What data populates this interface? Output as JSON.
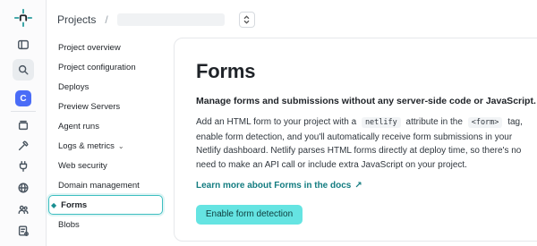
{
  "breadcrumb": {
    "projects_label": "Projects",
    "separator": "/"
  },
  "rail": {
    "team_initial": "C",
    "items": [
      "netlify-logo-icon",
      "sidebar-toggle-icon",
      "search-icon",
      "team-avatar",
      "projects-icon",
      "builds-icon",
      "extensions-icon",
      "domains-icon",
      "members-icon",
      "docs-icon"
    ]
  },
  "subnav": {
    "items": [
      {
        "label": "Project overview"
      },
      {
        "label": "Project configuration"
      },
      {
        "label": "Deploys"
      },
      {
        "label": "Preview Servers"
      },
      {
        "label": "Agent runs"
      },
      {
        "label": "Logs & metrics"
      },
      {
        "label": "Web security"
      },
      {
        "label": "Domain management"
      },
      {
        "label": "Forms"
      },
      {
        "label": "Blobs"
      }
    ],
    "logs_caret": "⌄",
    "active_marker": "◆"
  },
  "main": {
    "title": "Forms",
    "lead": "Manage forms and submissions without any server-side code or JavaScript.",
    "body_part1": "Add an HTML form to your project with a",
    "code1": "netlify",
    "body_part2": "attribute in the",
    "code2": "<form>",
    "body_part3": "tag, enable form detection, and you'll automatically receive form submissions in your Netlify dashboard. Netlify parses HTML forms directly at deploy time, so there's no need to make an API call or include extra JavaScript on your project.",
    "docs_link": "Learn more about Forms in the docs",
    "docs_arrow": "↗",
    "cta_label": "Enable form detection"
  },
  "colors": {
    "accent": "#65e4e2",
    "link": "#137c80",
    "team_badge": "#4a6cf7",
    "active_border": "#3dbec0"
  }
}
